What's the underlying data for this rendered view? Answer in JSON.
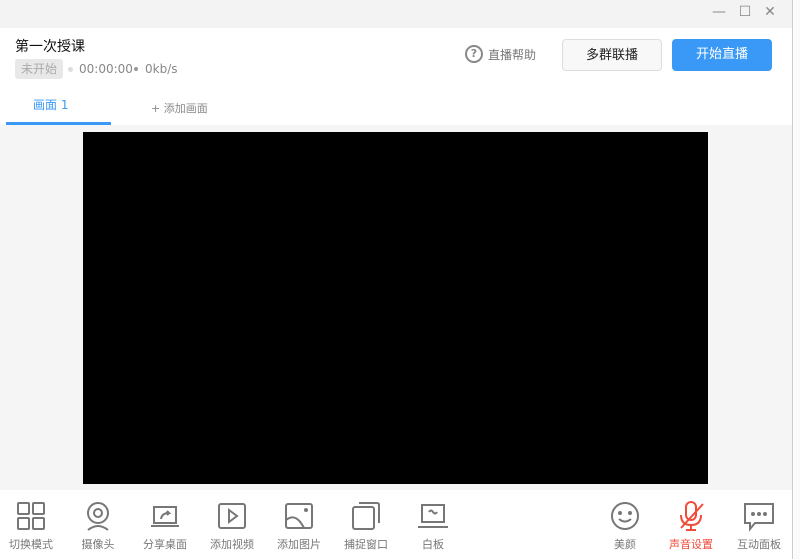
{
  "window": {
    "controls": {
      "minimize": "—",
      "maximize": "☐",
      "close": "✕"
    }
  },
  "header": {
    "title": "第一次授课",
    "status": "未开始",
    "duration": "00:00:00",
    "bitrate": "0kb/s",
    "help_label": "直播帮助",
    "multi_group_label": "多群联播",
    "start_label": "开始直播"
  },
  "tabs": [
    {
      "label": "画面 1",
      "active": true
    },
    {
      "label": "+ 添加画面"
    }
  ],
  "toolbar": {
    "left": [
      {
        "label": "切换模式",
        "icon": "grid-icon"
      },
      {
        "label": "摄像头",
        "icon": "webcam-icon"
      },
      {
        "label": "分享桌面",
        "icon": "share-screen-icon"
      },
      {
        "label": "添加视频",
        "icon": "video-icon"
      },
      {
        "label": "添加图片",
        "icon": "image-icon"
      },
      {
        "label": "捕捉窗口",
        "icon": "window-capture-icon"
      },
      {
        "label": "白板",
        "icon": "whiteboard-icon"
      }
    ],
    "right": [
      {
        "label": "美颜",
        "icon": "smile-icon"
      },
      {
        "label": "声音设置",
        "icon": "mic-muted-icon"
      },
      {
        "label": "互动面板",
        "icon": "chat-icon"
      }
    ]
  },
  "colors": {
    "accent": "#3a99f6",
    "danger": "#f04b3b"
  }
}
